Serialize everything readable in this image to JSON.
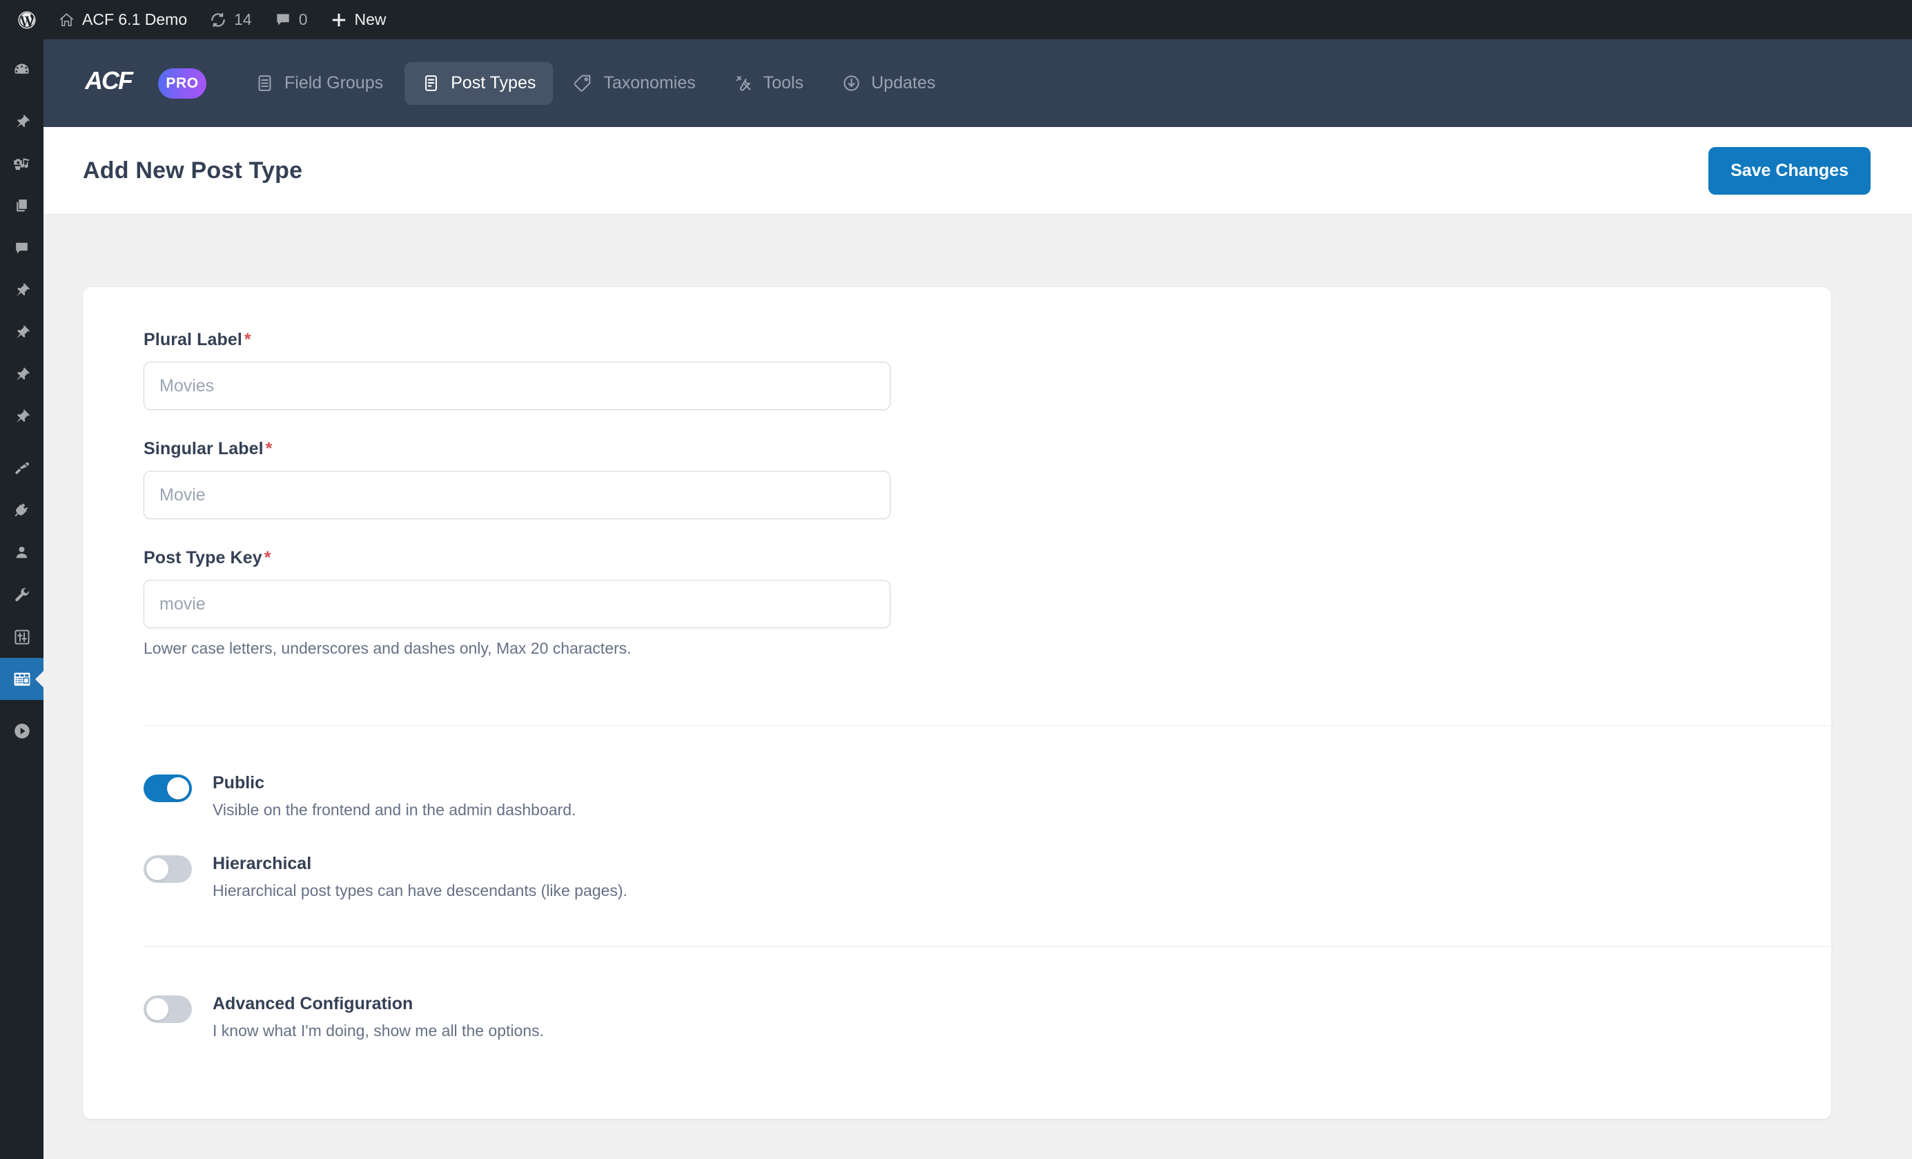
{
  "adminbar": {
    "wp_logo_icon": "wordpress-logo-icon",
    "site_home_icon": "home-icon",
    "site_name": "ACF 6.1 Demo",
    "updates_icon": "updates-refresh-icon",
    "updates_count": "14",
    "comments_icon": "comment-bubble-icon",
    "comments_count": "0",
    "new_icon": "plus-icon",
    "new_label": "New"
  },
  "sidebar": {
    "items": [
      {
        "name": "dashboard",
        "icon": "dashboard-gauge-icon",
        "active": false
      },
      {
        "name": "posts",
        "icon": "pin-icon",
        "active": false
      },
      {
        "name": "media",
        "icon": "media-camera-music-icon",
        "active": false
      },
      {
        "name": "pages",
        "icon": "pages-icon",
        "active": false
      },
      {
        "name": "comments",
        "icon": "comment-bubble-icon",
        "active": false
      },
      {
        "name": "movies",
        "icon": "pin-icon",
        "active": false
      },
      {
        "name": "custom-post-type-1",
        "icon": "pin-icon",
        "active": false
      },
      {
        "name": "custom-post-type-2",
        "icon": "pin-icon",
        "active": false
      },
      {
        "name": "custom-post-type-3",
        "icon": "pin-icon",
        "active": false
      },
      {
        "name": "appearance",
        "icon": "paintbrush-icon",
        "active": false
      },
      {
        "name": "plugins",
        "icon": "plug-icon",
        "active": false
      },
      {
        "name": "users",
        "icon": "user-icon",
        "active": false
      },
      {
        "name": "tools",
        "icon": "wrench-icon",
        "active": false
      },
      {
        "name": "settings",
        "icon": "sliders-settings-icon",
        "active": false
      },
      {
        "name": "acf",
        "icon": "acf-layout-icon",
        "active": true
      },
      {
        "name": "media-player",
        "icon": "play-circle-icon",
        "active": false
      }
    ]
  },
  "acf_header": {
    "logo_text": "ACF",
    "pro_badge": "PRO",
    "tabs": [
      {
        "label": "Field Groups",
        "icon": "field-groups-icon",
        "active": false
      },
      {
        "label": "Post Types",
        "icon": "post-types-icon",
        "active": true
      },
      {
        "label": "Taxonomies",
        "icon": "taxonomies-tag-icon",
        "active": false
      },
      {
        "label": "Tools",
        "icon": "tools-icon",
        "active": false
      },
      {
        "label": "Updates",
        "icon": "updates-download-icon",
        "active": false
      }
    ]
  },
  "titlebar": {
    "title": "Add New Post Type",
    "save_label": "Save Changes"
  },
  "form": {
    "fields": [
      {
        "label": "Plural Label",
        "required_marker": "*",
        "placeholder": "Movies",
        "value": "",
        "instruction": ""
      },
      {
        "label": "Singular Label",
        "required_marker": "*",
        "placeholder": "Movie",
        "value": "",
        "instruction": ""
      },
      {
        "label": "Post Type Key",
        "required_marker": "*",
        "placeholder": "movie",
        "value": "",
        "instruction": "Lower case letters, underscores and dashes only, Max 20 characters."
      }
    ],
    "toggles_group_1": [
      {
        "label": "Public",
        "description": "Visible on the frontend and in the admin dashboard.",
        "on": true
      },
      {
        "label": "Hierarchical",
        "description": "Hierarchical post types can have descendants (like pages).",
        "on": false
      }
    ],
    "toggles_group_2": [
      {
        "label": "Advanced Configuration",
        "description": "I know what I'm doing, show me all the options.",
        "on": false
      }
    ]
  },
  "colors": {
    "adminbar_bg": "#1d2327",
    "acf_header_bg": "#344054",
    "acf_tab_active_bg": "#475467",
    "accent_blue": "#1079bf",
    "wp_menu_active_blue": "#2271b1",
    "content_bg": "#f0f0f1",
    "required_red": "#d94f4f",
    "toggle_off": "#ccd0d9"
  }
}
